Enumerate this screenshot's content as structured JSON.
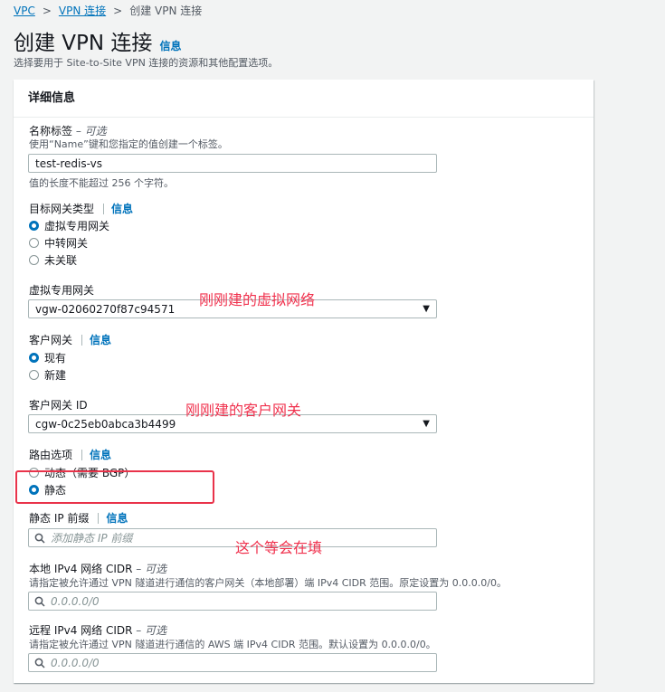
{
  "breadcrumb": {
    "items": [
      "VPC",
      "VPN 连接",
      "创建 VPN 连接"
    ]
  },
  "page": {
    "title": "创建 VPN 连接",
    "info_link": "信息",
    "subtitle": "选择要用于 Site-to-Site VPN 连接的资源和其他配置选项。"
  },
  "panel": {
    "header": "详细信息"
  },
  "name_tag": {
    "label": "名称标签",
    "optional": " – 可选",
    "description": "使用“Name”键和您指定的值创建一个标签。",
    "value": "test-redis-vs",
    "constraint": "值的长度不能超过 256 个字符。"
  },
  "target_gateway_type": {
    "label": "目标网关类型",
    "info": "信息",
    "options": [
      "虚拟专用网关",
      "中转网关",
      "未关联"
    ],
    "selected_index": 0
  },
  "virtual_private_gateway": {
    "label": "虚拟专用网关",
    "value": "vgw-02060270f87c94571"
  },
  "customer_gateway": {
    "label": "客户网关",
    "info": "信息",
    "options": [
      "现有",
      "新建"
    ],
    "selected_index": 0
  },
  "customer_gateway_id": {
    "label": "客户网关 ID",
    "value": "cgw-0c25eb0abca3b4499"
  },
  "routing_options": {
    "label": "路由选项",
    "info": "信息",
    "options": [
      "动态（需要 BGP）",
      "静态"
    ],
    "selected_index": 1
  },
  "static_ip_prefixes": {
    "label": "静态 IP 前缀",
    "info": "信息",
    "placeholder": "添加静态 IP 前缀"
  },
  "local_cidr": {
    "label": "本地 IPv4 网络 CIDR",
    "optional": " – 可选",
    "description": "请指定被允许通过 VPN 隧道进行通信的客户网关（本地部署）端 IPv4 CIDR 范围。原定设置为 0.0.0.0/0。",
    "placeholder": "0.0.0.0/0"
  },
  "remote_cidr": {
    "label": "远程 IPv4 网络 CIDR",
    "optional": " – 可选",
    "description": "请指定被允许通过 VPN 隧道进行通信的 AWS 端 IPv4 CIDR 范围。默认设置为 0.0.0.0/0。",
    "placeholder": "0.0.0.0/0"
  },
  "annotations": {
    "vgw_note": "刚刚建的虚拟网络",
    "cgw_note": "刚刚建的客户网关",
    "prefix_note": "这个等会在填"
  },
  "colors": {
    "accent": "#0073bb",
    "annotation": "#f0324e",
    "background": "#f2f3f3"
  }
}
